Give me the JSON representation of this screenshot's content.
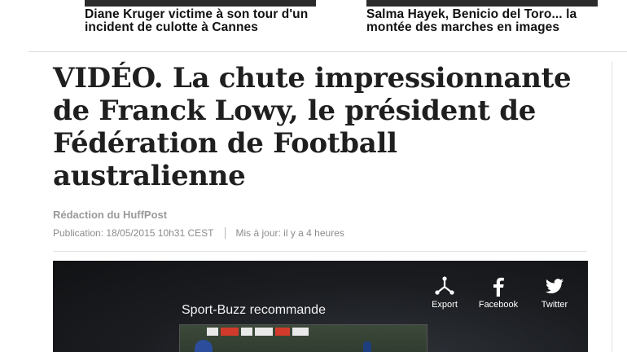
{
  "related": [
    {
      "title": "Diane Kruger victime à son tour d'un incident de culotte à Cannes"
    },
    {
      "title": "Salma Hayek, Benicio del Toro... la montée des marches en images"
    }
  ],
  "article": {
    "title": "VIDÉO. La chute impressionnante de Franck Lowy, le président de Fédération de Football australienne",
    "author": "Rédaction du HuffPost",
    "publication": "Publication: 18/05/2015 10h31 CEST",
    "updated": "Mis à jour: il y a 4 heures"
  },
  "video": {
    "recommend_label": "Sport-Buzz recommande",
    "share": [
      {
        "label": "Export",
        "icon": "export-icon"
      },
      {
        "label": "Facebook",
        "icon": "facebook-icon"
      },
      {
        "label": "Twitter",
        "icon": "twitter-icon"
      }
    ]
  }
}
